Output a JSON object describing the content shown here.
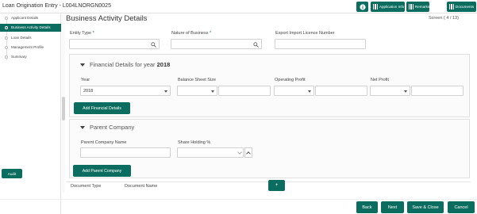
{
  "app": {
    "title": "Loan Origination Entry - L004LNORGN0025"
  },
  "toolbar": {
    "info_icon": "info-icon",
    "application_info_label": "Application Info",
    "remarks_label": "Remarks",
    "documents_label": "Documents"
  },
  "sidebar": {
    "items": [
      {
        "label": "Applicant Details",
        "active": false
      },
      {
        "label": "Business Activity Details",
        "active": true
      },
      {
        "label": "Loan Details",
        "active": false
      },
      {
        "label": "Management Profile",
        "active": false
      },
      {
        "label": "Summary",
        "active": false
      }
    ],
    "audit_label": "Audit"
  },
  "page": {
    "title": "Business Activity Details",
    "screen_indicator": "Screen ( 4 / 13)"
  },
  "form": {
    "entity_type_label": "Entity Type",
    "nature_of_business_label": "Nature of Business",
    "required_mark": "*",
    "export_import_licence_label": "Export Import Licence Number",
    "entity_type_value": "",
    "nature_of_business_value": "",
    "export_import_licence_value": ""
  },
  "financial": {
    "section_title_prefix": "Financial Details for year",
    "section_title_year": "2018",
    "year_label": "Year",
    "year_value": "2018",
    "balance_sheet_label": "Balance Sheet Size",
    "operating_profit_label": "Operating Profit",
    "net_profit_label": "Net Profit",
    "add_button_label": "Add Financial Details"
  },
  "parent": {
    "section_title": "Parent Company",
    "name_label": "Parent Company Name",
    "share_holding_label": "Share Holding %",
    "add_button_label": "Add Parent Company"
  },
  "documents_table": {
    "columns": [
      "Document Type",
      "Document Name"
    ],
    "add_button_label": "+"
  },
  "footer": {
    "back_label": "Back",
    "next_label": "Next",
    "save_close_label": "Save & Close",
    "cancel_label": "Cancel"
  },
  "colors": {
    "accent": "#0b6d60"
  }
}
